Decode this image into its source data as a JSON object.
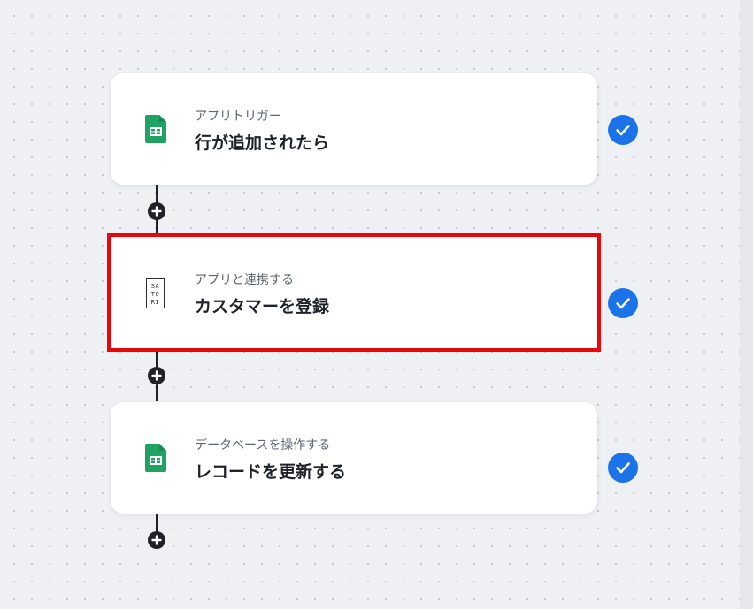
{
  "colors": {
    "background": "#eef0f4",
    "card": "#ffffff",
    "highlight": "#e8070b",
    "check": "#1a73e8",
    "connector": "#1f2329",
    "sheets_green": "#1ea362"
  },
  "steps": [
    {
      "kind": "アプリトリガー",
      "title": "行が追加されたら",
      "icon": "google-sheets-icon",
      "status": "complete-check-icon"
    },
    {
      "kind": "アプリと連携する",
      "title": "カスタマーを登録",
      "icon": "satori-logo",
      "logo_text": [
        "SA",
        "TO",
        "RI"
      ],
      "status": "complete-check-icon",
      "highlighted": true
    },
    {
      "kind": "データベースを操作する",
      "title": "レコードを更新する",
      "icon": "google-sheets-icon",
      "status": "complete-check-icon"
    }
  ],
  "add_step_icon": "plus-icon"
}
